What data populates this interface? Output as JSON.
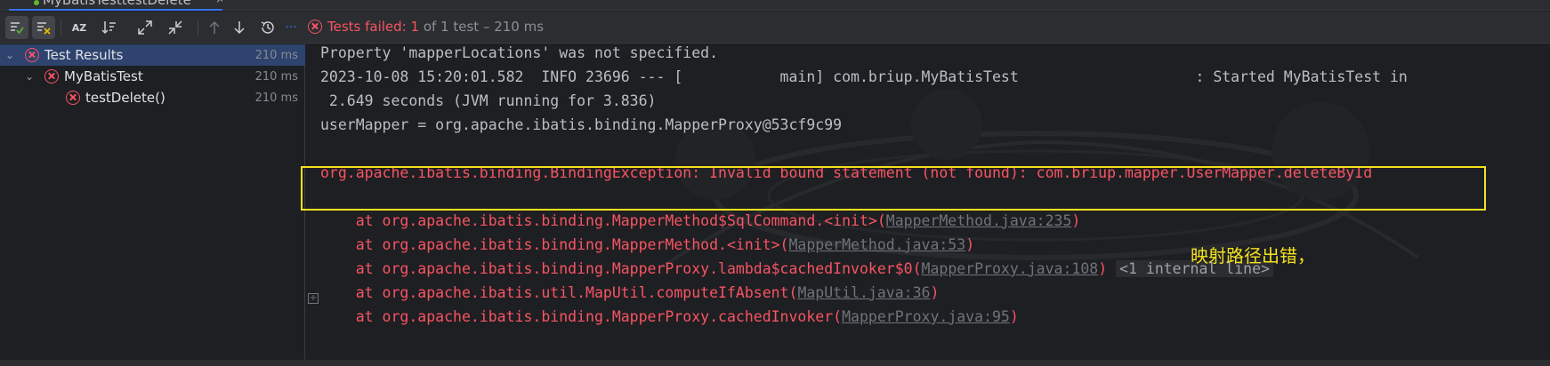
{
  "tab": {
    "title": "MyBatisTesttestDelete",
    "close": "×"
  },
  "toolbar": {
    "icons": [
      "check-filter-icon",
      "cancel-filter-icon",
      "sort-alpha-icon",
      "sort-duration-icon",
      "expand-all-icon",
      "collapse-all-icon",
      "arrow-up-icon",
      "arrow-down-icon",
      "history-icon",
      "more-icon"
    ],
    "az_label": "AZ",
    "more_label": "···",
    "status": {
      "prefix": "Tests failed: ",
      "failed": "1",
      "rest": " of 1 test – 210 ms"
    }
  },
  "tree": {
    "items": [
      {
        "label": "Test Results",
        "time": "210 ms",
        "status": "failed",
        "level": 0,
        "selected": true
      },
      {
        "label": "MyBatisTest",
        "time": "210 ms",
        "status": "failed",
        "level": 1
      },
      {
        "label": "testDelete()",
        "time": "210 ms",
        "status": "failed",
        "level": 2
      }
    ]
  },
  "console": {
    "lines": [
      "Property 'mapperLocations' was not specified.",
      "2023-10-08 15:20:01.582  INFO 23696 --- [           main] com.briup.MyBatisTest                    : Started MyBatisTest in",
      " 2.649 seconds (JVM running for 3.836)",
      "userMapper = org.apache.ibatis.binding.MapperProxy@53cf9c99"
    ],
    "exception": "org.apache.ibatis.binding.BindingException: Invalid bound statement (not found): com.briup.mapper.UserMapper.deleteById",
    "stack": [
      {
        "text": "    at org.apache.ibatis.binding.MapperMethod$SqlCommand.<init>(",
        "link": "MapperMethod.java:235",
        "tail": ")"
      },
      {
        "text": "    at org.apache.ibatis.binding.MapperMethod.<init>(",
        "link": "MapperMethod.java:53",
        "tail": ")"
      },
      {
        "text": "    at org.apache.ibatis.binding.MapperProxy.lambda$cachedInvoker$0(",
        "link": "MapperProxy.java:108",
        "tail": ") ",
        "extra": "<1 internal line>"
      },
      {
        "text": "    at org.apache.ibatis.util.MapUtil.computeIfAbsent(",
        "link": "MapUtil.java:36",
        "tail": ")"
      },
      {
        "text": "    at org.apache.ibatis.binding.MapperProxy.cachedInvoker(",
        "link": "MapperProxy.java:95",
        "tail": ")"
      }
    ],
    "annotation": "映射路径出错，",
    "gutter_expand": "+"
  },
  "colors": {
    "error": "#f75464",
    "highlight_box": "#f5e11e",
    "selection": "#2e436e",
    "background": "#1e1f22"
  }
}
